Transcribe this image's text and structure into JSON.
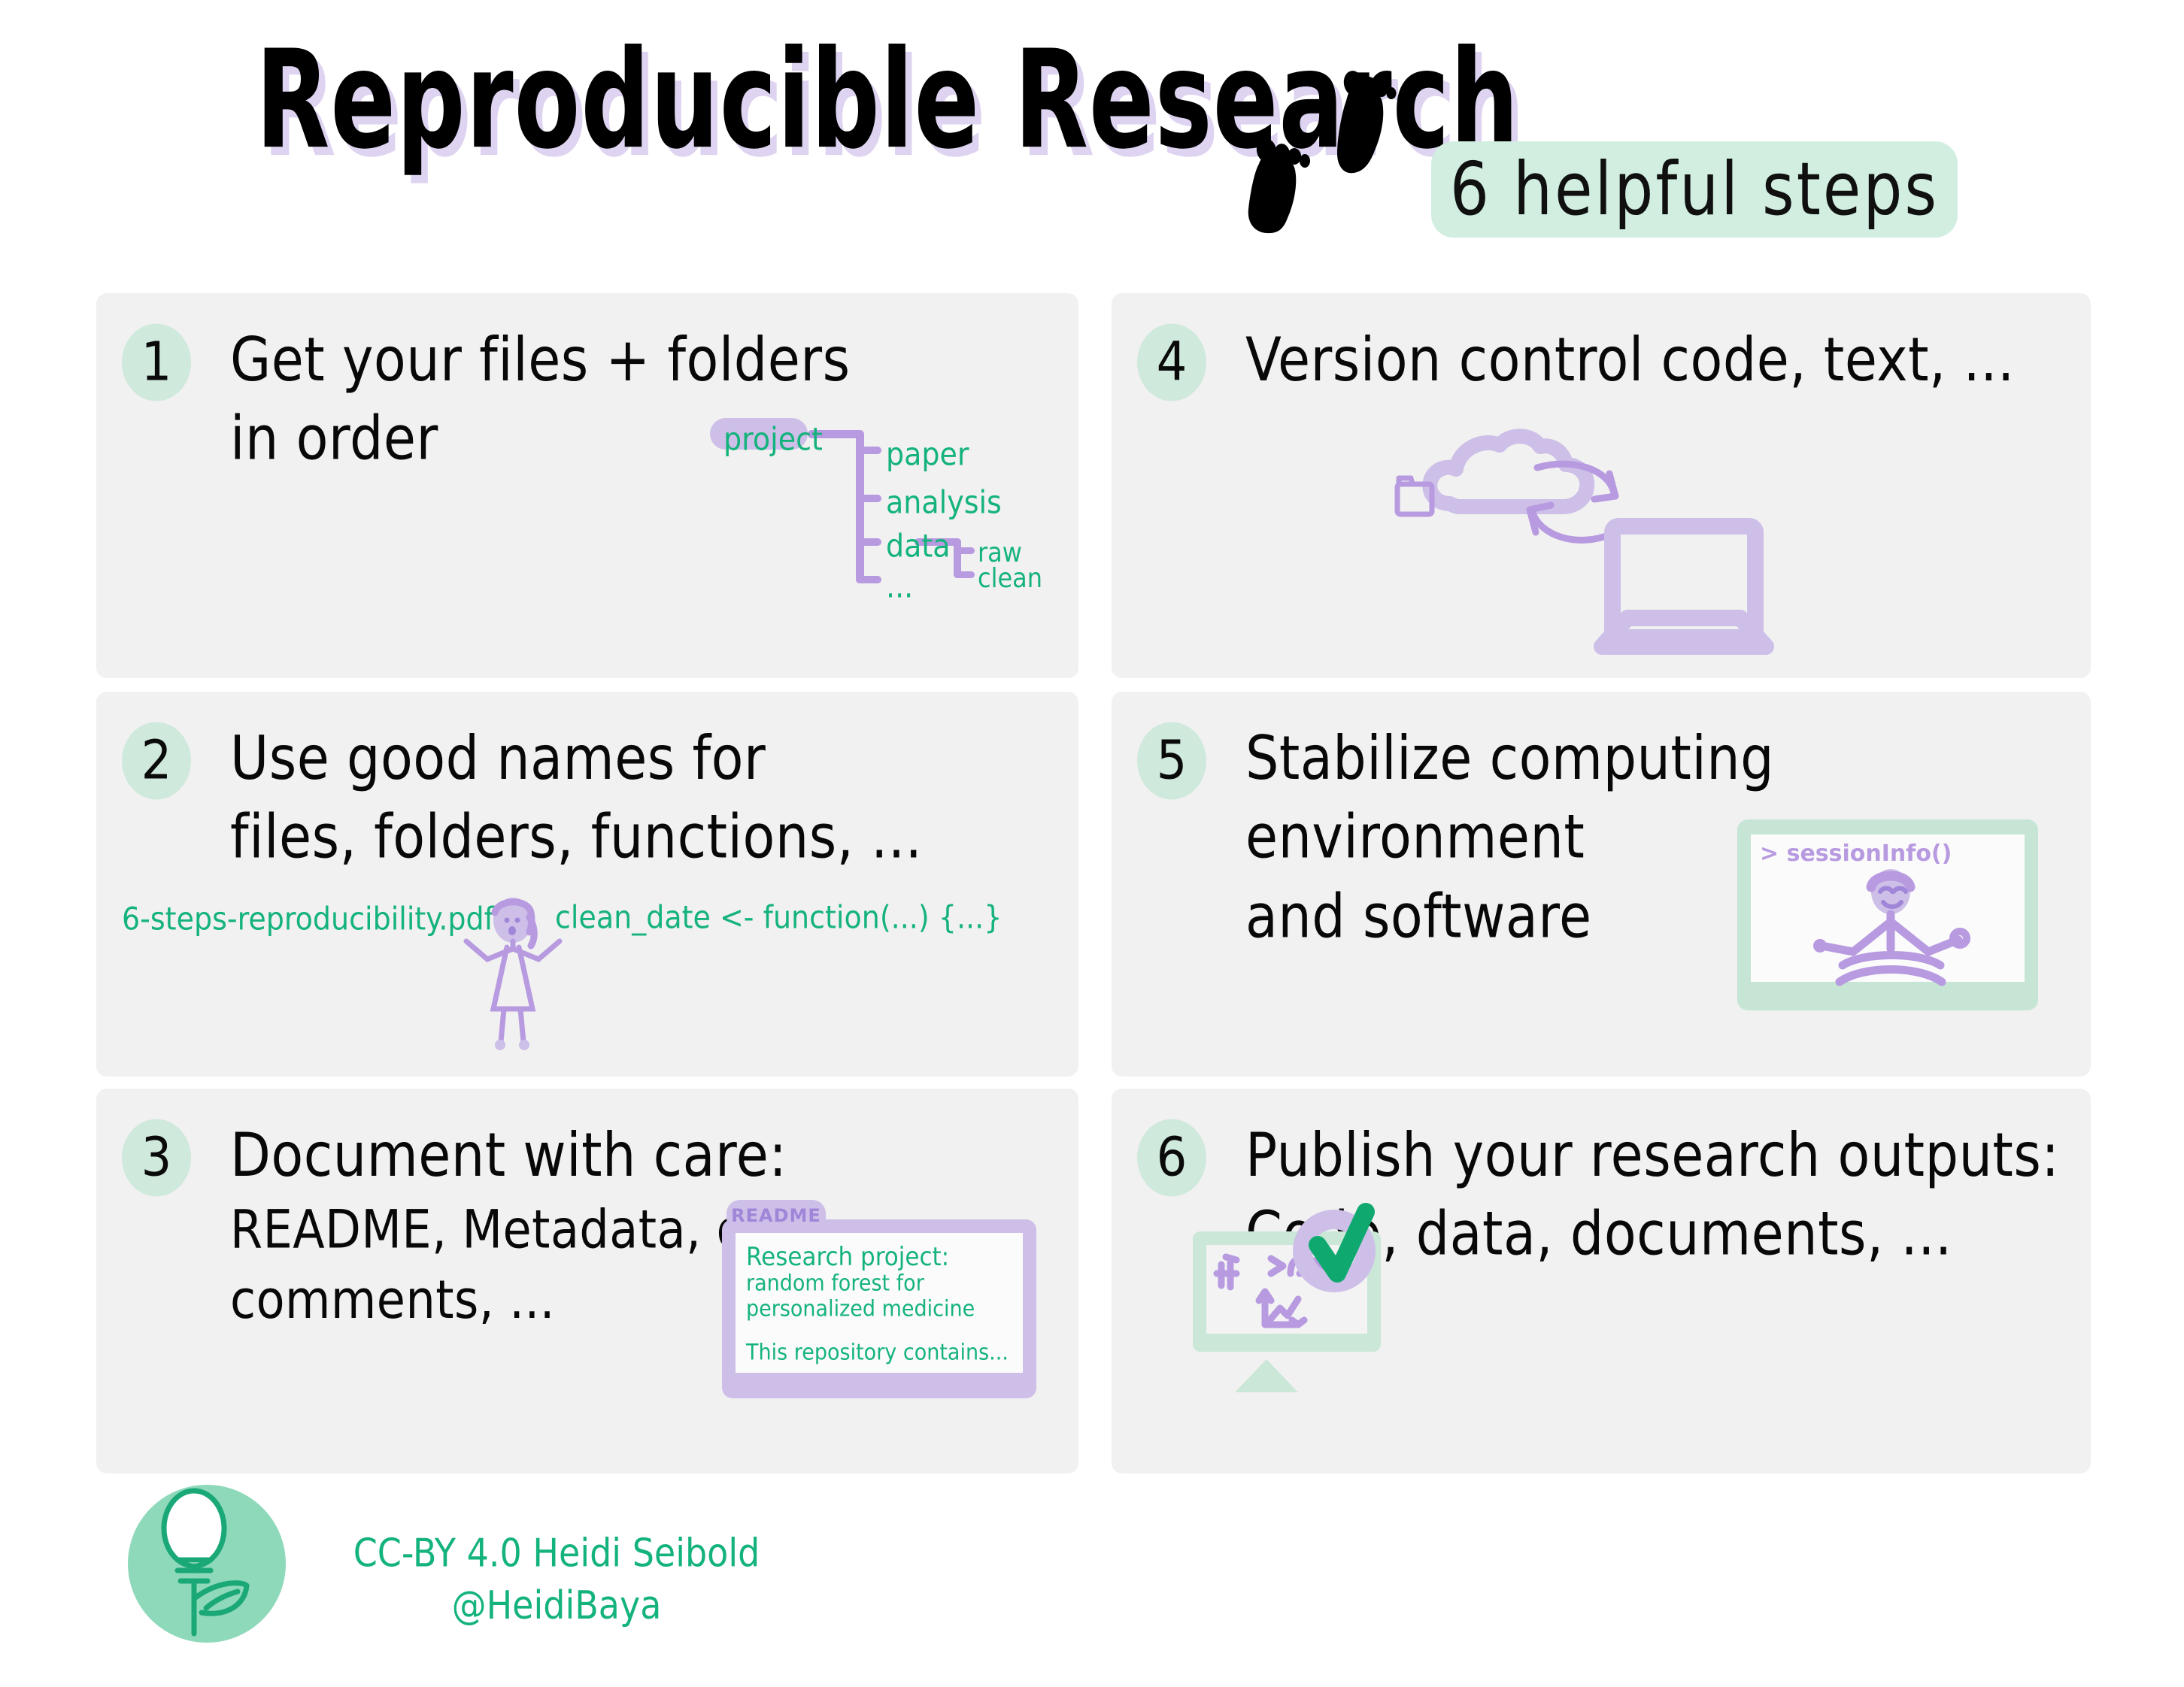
{
  "header": {
    "title": "Reproducible Research",
    "badge": "6   helpful   steps",
    "footprints_icon": "footprints-icon"
  },
  "colors": {
    "mint_badge": "#d1eee0",
    "mint_number": "#cfe9dc",
    "card_bg": "#f1f1f1",
    "green_ink": "#15b37c",
    "purple_ink": "#b79ae0",
    "purple_fill": "#cdbfe8",
    "title_shadow": "#ded3f0",
    "logo_green": "#8fd9bb",
    "black_ink": "#080808"
  },
  "steps": [
    {
      "number": "1",
      "line1": "Get your files + folders",
      "line2": "in order",
      "art": "folder-tree"
    },
    {
      "number": "2",
      "line1": "Use good names for",
      "line2": "files, folders, functions, ...",
      "art": "naming-examples"
    },
    {
      "number": "3",
      "line1": "Document with care:",
      "line2": "README, Metadata, code comments, ...",
      "art": "readme-window"
    },
    {
      "number": "4",
      "line1": "Version control code, text, ...",
      "line2": "",
      "art": "cloud-sync-laptop"
    },
    {
      "number": "5",
      "line1": "Stabilize computing environment",
      "line2": "and software",
      "art": "session-info-screen"
    },
    {
      "number": "6",
      "line1": "Publish your research outputs:",
      "line2": "Code, data, documents, ...",
      "art": "publish-monitor-check"
    }
  ],
  "folder_tree": {
    "root": "project",
    "children": [
      "paper",
      "analysis",
      "data",
      "..."
    ],
    "data_children": [
      "raw",
      "clean"
    ]
  },
  "naming_examples": {
    "filename": "6-steps-reproducibility.pdf",
    "function": "clean_date <- function(...) {...}"
  },
  "readme": {
    "tab_label": "README",
    "line1": "Research project:",
    "line2": "random forest for",
    "line3": "personalized medicine",
    "line4": "This repository contains..."
  },
  "session": {
    "command": "> sessionInfo()"
  },
  "footer": {
    "logo_icon": "lightbulb-plant-icon",
    "license_line": "CC-BY 4.0 Heidi Seibold",
    "handle": "@HeidiBaya"
  }
}
